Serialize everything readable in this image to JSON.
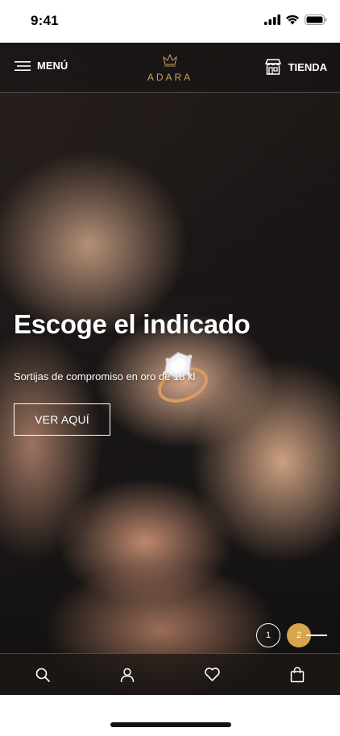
{
  "status_bar": {
    "time": "9:41",
    "icons": [
      "signal-icon",
      "wifi-icon",
      "battery-icon"
    ]
  },
  "nav": {
    "menu_label": "MENÚ",
    "store_label": "TIENDA",
    "logo_text": "ADARA",
    "logo_color": "#c9a25a"
  },
  "hero": {
    "title": "Escoge el indicado",
    "subtitle": "Sortijas de compromiso en oro de 18 kl",
    "cta_label": "VER AQUÍ"
  },
  "pager": {
    "pages": [
      "1",
      "2"
    ],
    "active_page": "2",
    "accent_color": "#d7a54e"
  },
  "bottom_tabs": [
    {
      "name": "search",
      "icon": "search-icon"
    },
    {
      "name": "account",
      "icon": "user-icon"
    },
    {
      "name": "favorites",
      "icon": "heart-icon"
    },
    {
      "name": "cart",
      "icon": "shopping-bag-icon"
    }
  ]
}
